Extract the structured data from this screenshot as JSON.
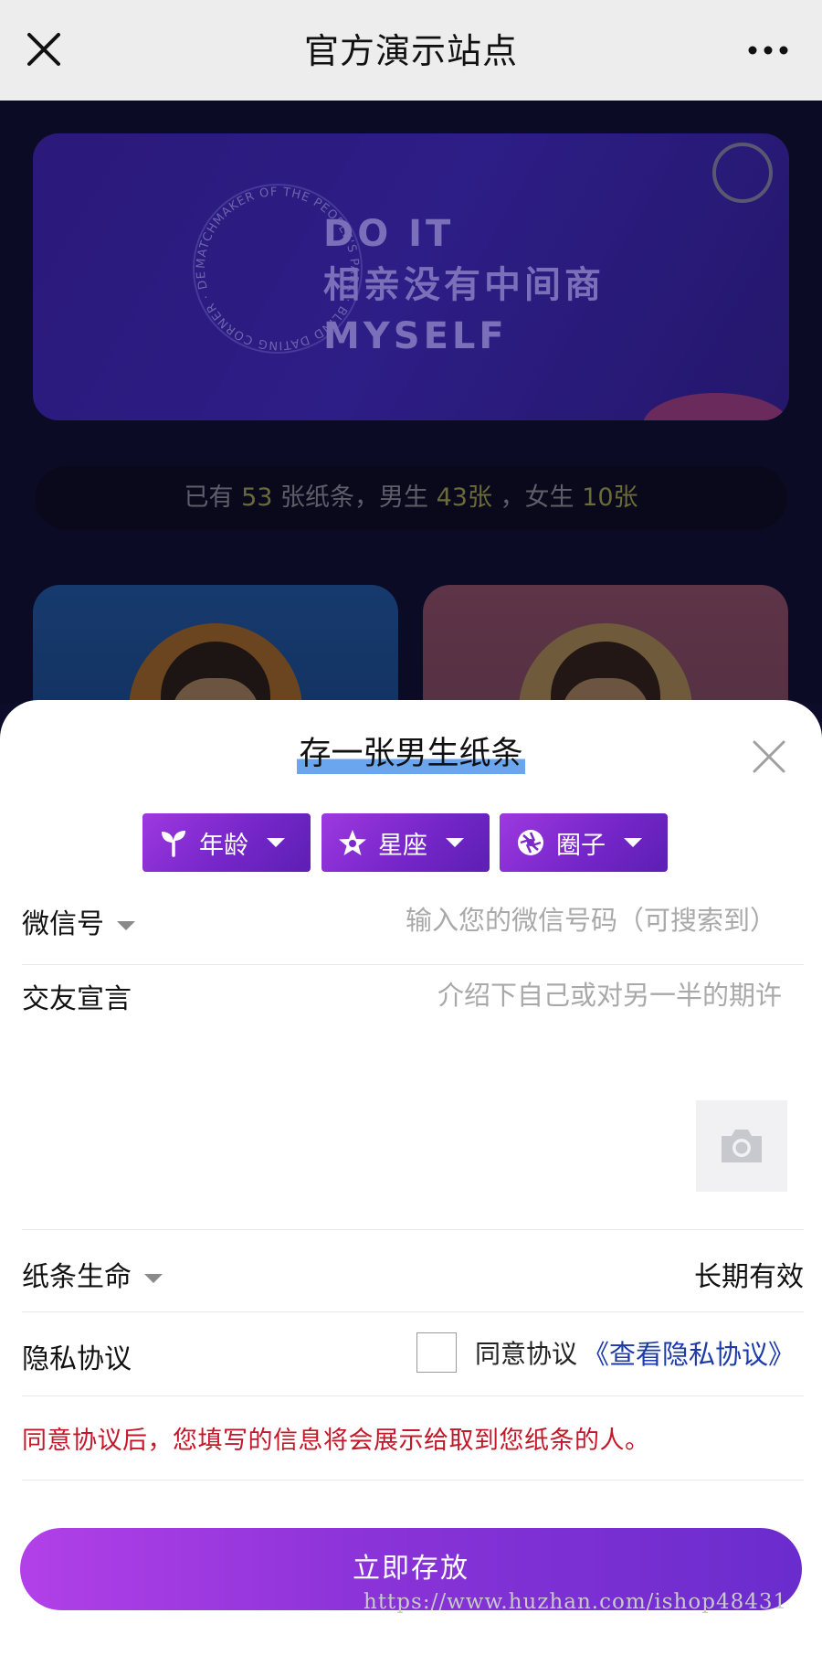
{
  "topbar": {
    "title": "官方演示站点",
    "close_icon": "close-icon",
    "more_icon": "more-icon"
  },
  "banner": {
    "line1": "DO IT",
    "line2": "相亲没有中间商",
    "line3": "MYSELF",
    "ring_text": "MATCHMAKER OF THE PEOPLE'S PARK · BLIND DATING CORNER · DESTINED"
  },
  "stats": {
    "prefix": "已有",
    "total": "53",
    "mid1": "张纸条，男生",
    "male": "43张",
    "mid2": "，女生",
    "female": "10张"
  },
  "sheet": {
    "title": "存一张男生纸条",
    "filters": [
      {
        "label": "年龄",
        "icon": "sprout-icon"
      },
      {
        "label": "星座",
        "icon": "star-icon"
      },
      {
        "label": "圈子",
        "icon": "aperture-icon"
      }
    ],
    "wechat": {
      "label": "微信号",
      "placeholder": "输入您的微信号码（可搜索到）"
    },
    "declaration": {
      "label": "交友宣言",
      "placeholder": "介绍下自己或对另一半的期许"
    },
    "lifetime": {
      "label": "纸条生命",
      "value": "长期有效"
    },
    "privacy": {
      "label": "隐私协议",
      "agree_text": "同意协议",
      "link_text": "《查看隐私协议》",
      "checked": false
    },
    "notice": "同意协议后，您填写的信息将会展示给取到您纸条的人。",
    "submit": "立即存放"
  },
  "watermark": "https://www.huzhan.com/ishop48431",
  "colors": {
    "accent_purple": "#8a33d8",
    "notice_red": "#c3182a",
    "link_blue": "#1e3aa8"
  }
}
